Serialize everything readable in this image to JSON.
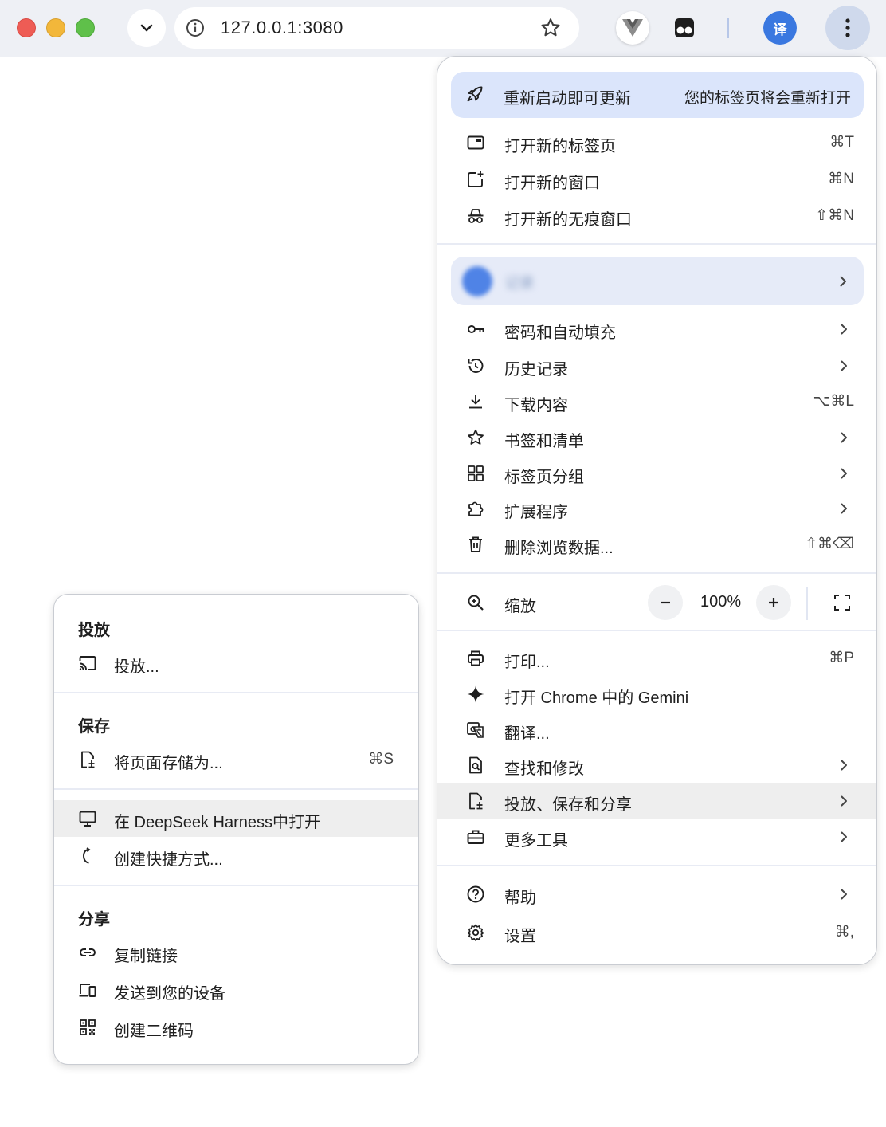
{
  "browser": {
    "url": "127.0.0.1:3080",
    "translate_ext_text": "译"
  },
  "menu": {
    "update": {
      "label": "重新启动即可更新",
      "note": "您的标签页将会重新打开"
    },
    "group1": [
      {
        "label": "打开新的标签页",
        "shortcut": "⌘T"
      },
      {
        "label": "打开新的窗口",
        "shortcut": "⌘N"
      },
      {
        "label": "打开新的无痕窗口",
        "shortcut": "⇧⌘N"
      }
    ],
    "profile": {
      "name": "记录"
    },
    "group2": [
      {
        "label": "密码和自动填充"
      },
      {
        "label": "历史记录"
      },
      {
        "label": "下载内容",
        "shortcut": "⌥⌘L"
      },
      {
        "label": "书签和清单"
      },
      {
        "label": "标签页分组"
      },
      {
        "label": "扩展程序"
      },
      {
        "label": "删除浏览数据...",
        "shortcut": "⇧⌘⌫"
      }
    ],
    "zoom": {
      "label": "缩放",
      "value": "100%"
    },
    "group3": [
      {
        "label": "打印...",
        "shortcut": "⌘P"
      },
      {
        "label": "打开 Chrome 中的 Gemini"
      },
      {
        "label": "翻译..."
      },
      {
        "label": "查找和修改"
      },
      {
        "label": "投放、保存和分享"
      },
      {
        "label": "更多工具"
      }
    ],
    "group4": [
      {
        "label": "帮助"
      },
      {
        "label": "设置",
        "shortcut": "⌘,"
      }
    ]
  },
  "submenu": {
    "cast_header": "投放",
    "cast_item": "投放...",
    "save_header": "保存",
    "save_item": {
      "label": "将页面存储为...",
      "shortcut": "⌘S"
    },
    "open_in_app": "在 DeepSeek Harness中打开",
    "create_shortcut": "创建快捷方式...",
    "share_header": "分享",
    "copy_link": "复制链接",
    "send_to_devices": "发送到您的设备",
    "create_qr": "创建二维码"
  }
}
